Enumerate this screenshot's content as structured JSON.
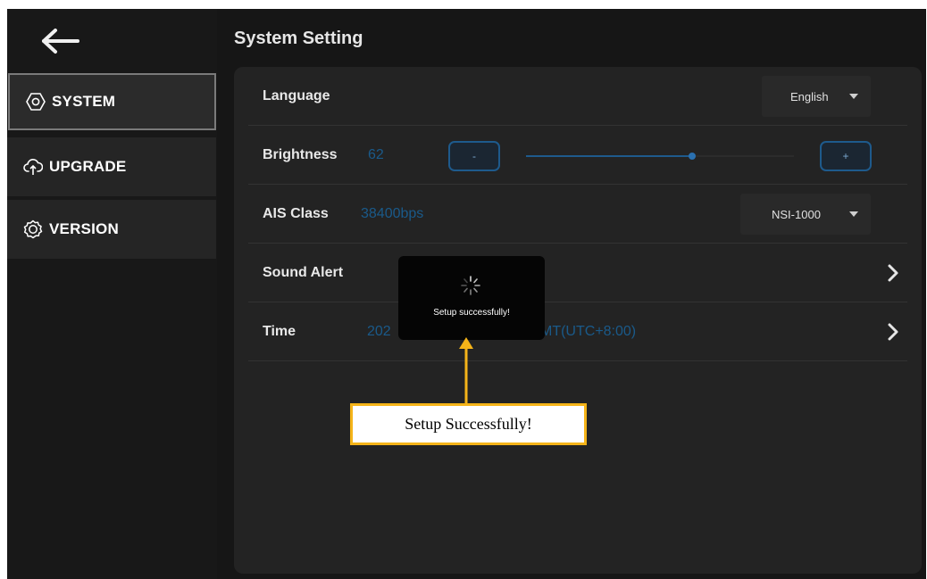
{
  "sidebar": {
    "items": [
      {
        "label": "SYSTEM",
        "icon": "hexagon-settings-icon",
        "active": true
      },
      {
        "label": "UPGRADE",
        "icon": "cloud-upload-icon",
        "active": false
      },
      {
        "label": "VERSION",
        "icon": "badge-icon",
        "active": false
      }
    ]
  },
  "header": {
    "title": "System Setting"
  },
  "settings": {
    "language": {
      "label": "Language",
      "selected": "English"
    },
    "brightness": {
      "label": "Brightness",
      "value": "62",
      "minus_label": "-",
      "plus_label": "+",
      "level_percent": 62
    },
    "ais_class": {
      "label": "AIS Class",
      "value": "38400bps",
      "selected": "NSI-1000"
    },
    "sound_alert": {
      "label": "Sound Alert"
    },
    "time": {
      "label": "Time",
      "value": "202",
      "value_suffix": "MT(UTC+8:00)"
    }
  },
  "toast": {
    "text": "Setup successfully!"
  },
  "callout": {
    "text": "Setup Successfully!"
  },
  "colors": {
    "accent": "#1e5a8c",
    "value_text": "#1a5a8a",
    "callout_border": "#f5b419",
    "background": "#161616",
    "panel": "#232323"
  }
}
